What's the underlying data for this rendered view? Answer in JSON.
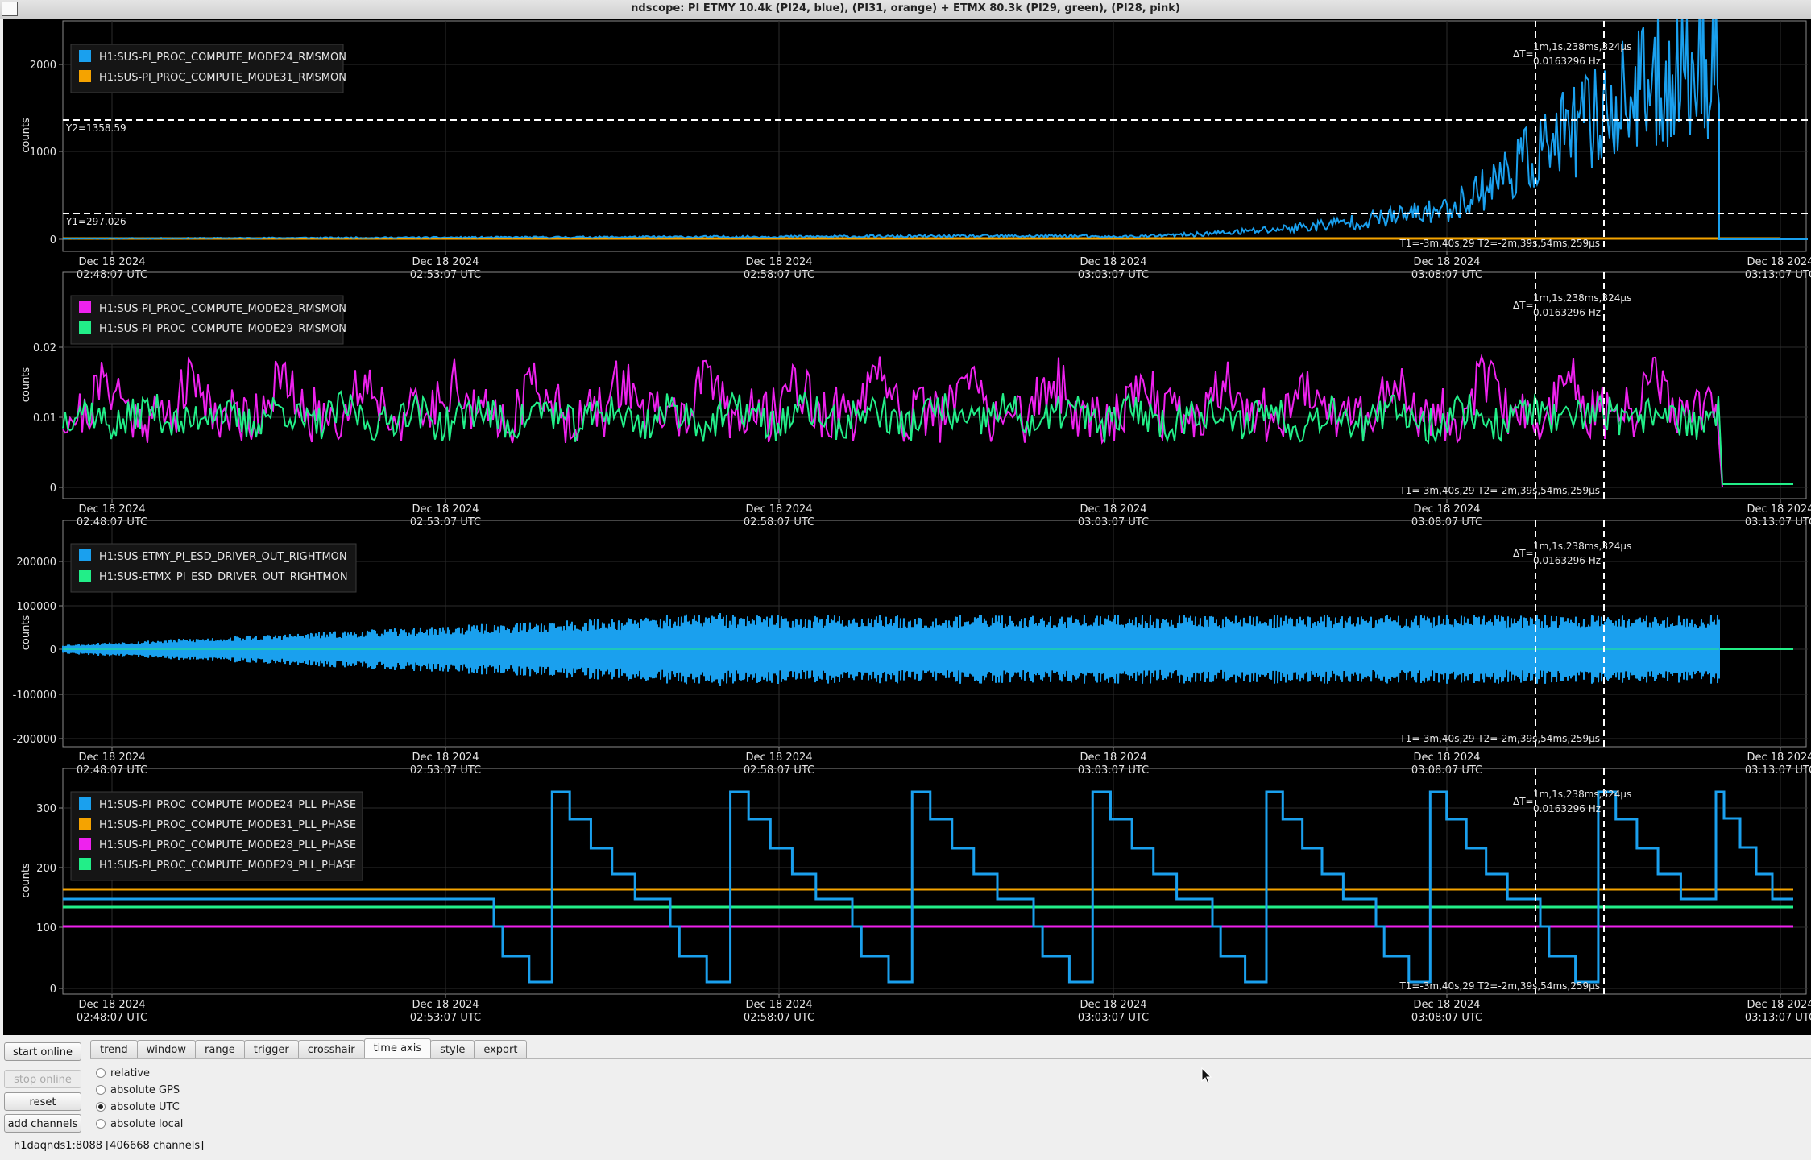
{
  "window": {
    "title": "ndscope: PI ETMY 10.4k (PI24, blue), (PI31, orange) + ETMX 80.3k (PI29, green), (PI28, pink)"
  },
  "colors": {
    "blue": "#1aa0ee",
    "orange": "#f5a300",
    "magenta": "#ee22ee",
    "green": "#22ee88",
    "grid": "#2c2c2c",
    "axis": "#8a8a8a",
    "text": "#e6e6e6",
    "cursor": "#ffffff"
  },
  "time_axis": {
    "ticks": [
      {
        "date": "Dec 18 2024",
        "time": "02:48:07 UTC"
      },
      {
        "date": "Dec 18 2024",
        "time": "02:53:07 UTC"
      },
      {
        "date": "Dec 18 2024",
        "time": "02:58:07 UTC"
      },
      {
        "date": "Dec 18 2024",
        "time": "03:03:07 UTC"
      },
      {
        "date": "Dec 18 2024",
        "time": "03:08:07 UTC"
      },
      {
        "date": "Dec 18 2024",
        "time": "03:13:07 UTC"
      }
    ]
  },
  "cursor_readout": {
    "delta_label": "ΔT=",
    "delta_value": "1m,1s,238ms,324μs",
    "delta_freq": "0.0163296 Hz",
    "t_values": "T1=-3m,40s,29 T2=-2m,39s,54ms,259μs"
  },
  "plots": [
    {
      "ylabel": "counts",
      "yticks": [
        "2000",
        "1000",
        "0"
      ],
      "legend": [
        {
          "label": "H1:SUS-PI_PROC_COMPUTE_MODE24_RMSMON",
          "color": "#1aa0ee"
        },
        {
          "label": "H1:SUS-PI_PROC_COMPUTE_MODE31_RMSMON",
          "color": "#f5a300"
        }
      ],
      "y_cursors": [
        {
          "label": "Y2=1358.59"
        },
        {
          "label": "Y1=297.026"
        }
      ]
    },
    {
      "ylabel": "counts",
      "yticks": [
        "0.02",
        "0.01",
        "0"
      ],
      "legend": [
        {
          "label": "H1:SUS-PI_PROC_COMPUTE_MODE28_RMSMON",
          "color": "#ee22ee"
        },
        {
          "label": "H1:SUS-PI_PROC_COMPUTE_MODE29_RMSMON",
          "color": "#22ee88"
        }
      ]
    },
    {
      "ylabel": "counts",
      "yticks": [
        "200000",
        "100000",
        "0",
        "-100000",
        "-200000"
      ],
      "legend": [
        {
          "label": "H1:SUS-ETMY_PI_ESD_DRIVER_OUT_RIGHTMON",
          "color": "#1aa0ee"
        },
        {
          "label": "H1:SUS-ETMX_PI_ESD_DRIVER_OUT_RIGHTMON",
          "color": "#22ee88"
        }
      ]
    },
    {
      "ylabel": "counts",
      "yticks": [
        "300",
        "200",
        "100",
        "0"
      ],
      "legend": [
        {
          "label": "H1:SUS-PI_PROC_COMPUTE_MODE24_PLL_PHASE",
          "color": "#1aa0ee"
        },
        {
          "label": "H1:SUS-PI_PROC_COMPUTE_MODE31_PLL_PHASE",
          "color": "#f5a300"
        },
        {
          "label": "H1:SUS-PI_PROC_COMPUTE_MODE28_PLL_PHASE",
          "color": "#ee22ee"
        },
        {
          "label": "H1:SUS-PI_PROC_COMPUTE_MODE29_PLL_PHASE",
          "color": "#22ee88"
        }
      ]
    }
  ],
  "buttons": {
    "start_online": "start online",
    "stop_online": "stop online",
    "reset": "reset",
    "add_channels": "add channels"
  },
  "tabs": [
    "trend",
    "window",
    "range",
    "trigger",
    "crosshair",
    "time axis",
    "style",
    "export"
  ],
  "active_tab": "time axis",
  "time_axis_options": [
    {
      "label": "relative",
      "checked": false
    },
    {
      "label": "absolute GPS",
      "checked": false
    },
    {
      "label": "absolute UTC",
      "checked": true
    },
    {
      "label": "absolute local",
      "checked": false
    }
  ],
  "status": "h1daqnds1:8088  [406668 channels]"
}
